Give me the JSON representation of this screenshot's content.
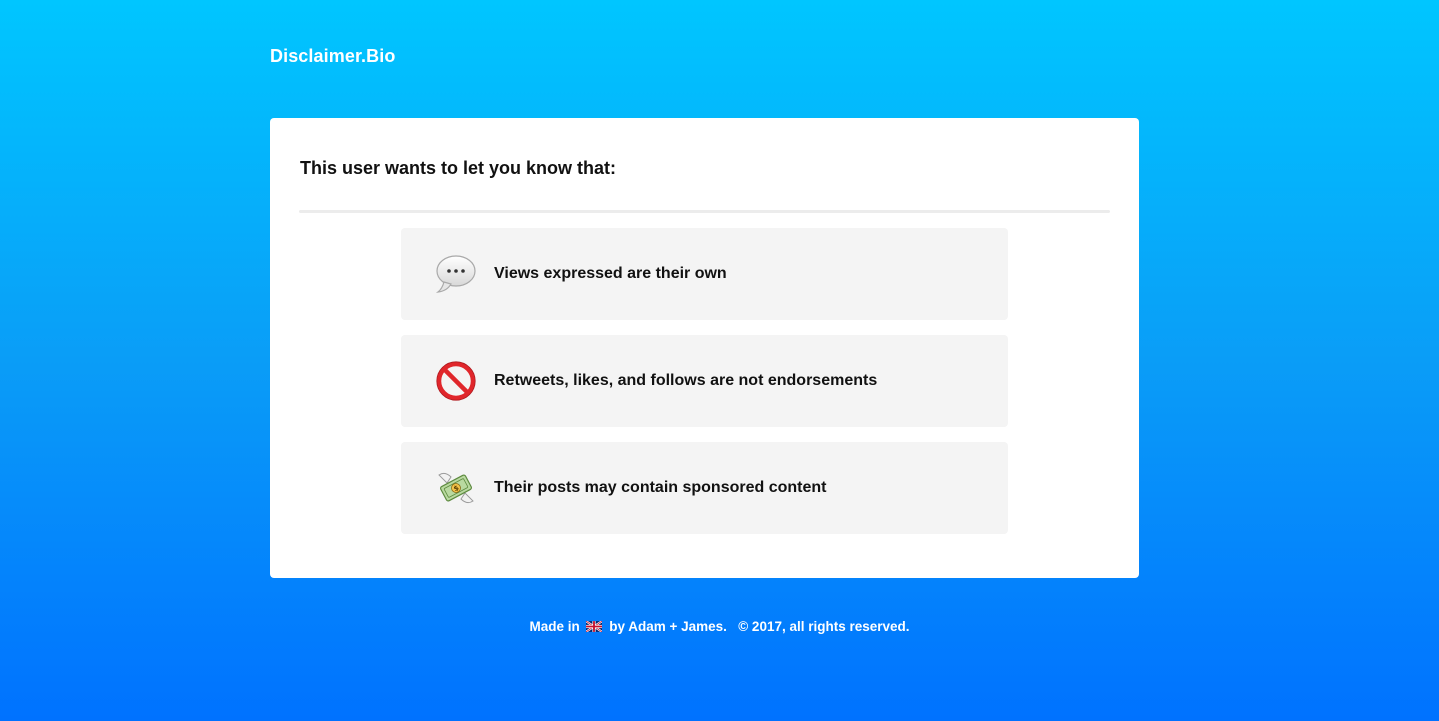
{
  "brand": {
    "name": "Disclaimer.Bio"
  },
  "card": {
    "title": "This user wants to let you know that:",
    "items": [
      {
        "icon": "speech-bubble-icon",
        "text": "Views expressed are their own"
      },
      {
        "icon": "prohibited-icon",
        "text": "Retweets, likes, and follows are not endorsements"
      },
      {
        "icon": "money-with-wings-icon",
        "text": "Their posts may contain sponsored content"
      }
    ]
  },
  "footer": {
    "made_in": "Made in",
    "flag_icon": "uk-flag-icon",
    "by": "by Adam + James.",
    "copyright": "© 2017, all rights reserved."
  },
  "colors": {
    "gradient_top": "#00c6ff",
    "gradient_bottom": "#0072ff",
    "card_bg": "#ffffff",
    "item_bg": "#f4f4f4"
  }
}
